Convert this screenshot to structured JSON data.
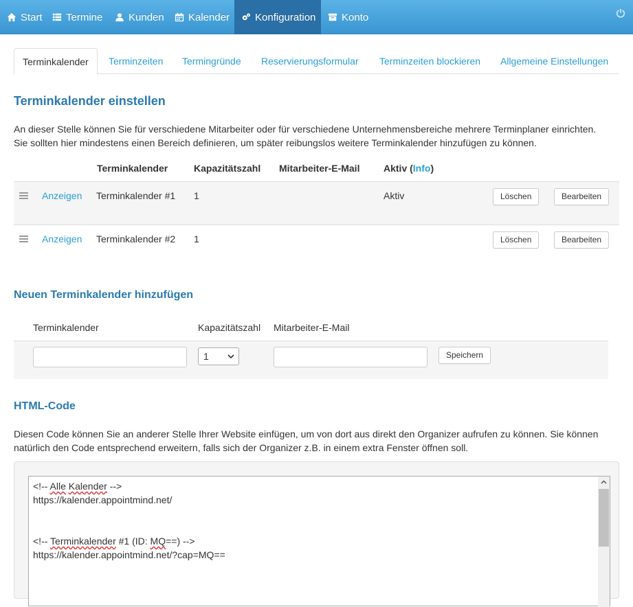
{
  "nav": {
    "items": [
      {
        "label": "Start",
        "icon": "home-icon"
      },
      {
        "label": "Termine",
        "icon": "list-icon"
      },
      {
        "label": "Kunden",
        "icon": "user-icon"
      },
      {
        "label": "Kalender",
        "icon": "calendar-icon"
      },
      {
        "label": "Konfiguration",
        "icon": "gears-icon",
        "active": true
      },
      {
        "label": "Konto",
        "icon": "archive-icon"
      }
    ],
    "logout_icon": "power-icon"
  },
  "tabs": [
    {
      "label": "Terminkalender",
      "active": true
    },
    {
      "label": "Terminzeiten"
    },
    {
      "label": "Termingründe"
    },
    {
      "label": "Reservierungsformular"
    },
    {
      "label": "Terminzeiten blockieren"
    },
    {
      "label": "Allgemeine Einstellungen"
    }
  ],
  "calendars": {
    "title": "Terminkalender einstellen",
    "description_line1": "An dieser Stelle können Sie für verschiedene Mitarbeiter oder für verschiedene Unternehmensbereiche mehrere Terminplaner einrichten.",
    "description_line2": "Sie sollten hier mindestens einen Bereich definieren, um später reibungslos weitere Terminkalender hinzufügen zu können.",
    "headers": {
      "calendar": "Terminkalender",
      "capacity": "Kapazitätszahl",
      "email": "Mitarbeiter-E-Mail",
      "active_prefix": "Aktiv (",
      "active_info": "Info",
      "active_suffix": ")"
    },
    "rows": [
      {
        "show": "Anzeigen",
        "name": "Terminkalender #1",
        "capacity": "1",
        "email": "",
        "active": "Aktiv",
        "delete": "Löschen",
        "edit": "Bearbeiten"
      },
      {
        "show": "Anzeigen",
        "name": "Terminkalender #2",
        "capacity": "1",
        "email": "",
        "active": "",
        "delete": "Löschen",
        "edit": "Bearbeiten"
      }
    ]
  },
  "add_form": {
    "title": "Neuen Terminkalender hinzufügen",
    "headers": {
      "calendar": "Terminkalender",
      "capacity": "Kapazitätszahl",
      "email": "Mitarbeiter-E-Mail"
    },
    "calendar_value": "",
    "capacity_value": "1",
    "email_value": "",
    "save": "Speichern"
  },
  "html_code": {
    "title": "HTML-Code",
    "description_line1": "Diesen Code können Sie an anderer Stelle Ihrer Website einfügen, um von dort aus direkt den Organizer aufrufen zu können. Sie können",
    "description_line2": "natürlich den Code entsprechend erweitern, falls sich der Organizer z.B. in einem extra Fenster öffnen soll.",
    "lines": {
      "l1_a": "<!-- ",
      "l1_b": "Alle",
      "l1_c": " ",
      "l1_d": "Kalender",
      "l1_e": " -->",
      "l2": "https://kalender.appointmind.net/",
      "l3_a": "<!-- ",
      "l3_b": "Terminkalender",
      "l3_c": " #1 (ID: ",
      "l3_d": "MQ",
      "l3_e": "==) -->",
      "l4": "https://kalender.appointmind.net/?cap=MQ=="
    }
  }
}
